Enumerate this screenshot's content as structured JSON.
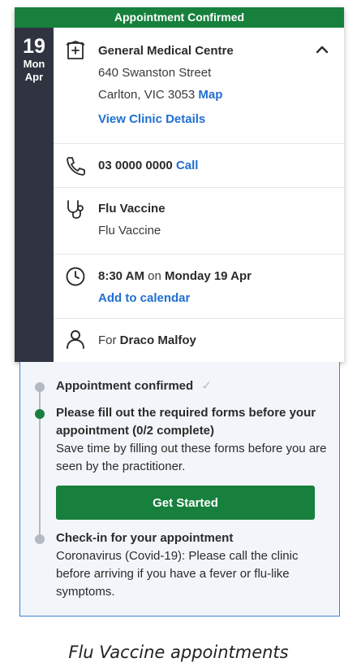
{
  "banner": {
    "text": "Appointment Confirmed"
  },
  "date": {
    "day": "19",
    "weekday": "Mon",
    "month": "Apr"
  },
  "clinic": {
    "name": "General Medical Centre",
    "address_line1": "640 Swanston Street",
    "address_line2": "Carlton, VIC 3053",
    "map_label": "Map",
    "details_label": "View Clinic Details"
  },
  "phone": {
    "number": "03 0000 0000",
    "call_label": "Call"
  },
  "service": {
    "name": "Flu Vaccine",
    "subtitle": "Flu Vaccine"
  },
  "time": {
    "time": "8:30 AM",
    "on": "on",
    "date": "Monday 19 Apr",
    "add_to_calendar": "Add to calendar"
  },
  "patient": {
    "for": "For",
    "name": "Draco Malfoy"
  },
  "steps": {
    "confirmed": {
      "title": "Appointment confirmed",
      "check": "✓"
    },
    "forms": {
      "title": "Please fill out the required forms before your appointment (0/2 complete)",
      "desc": "Save time by filling out these forms before you are seen by the practitioner.",
      "button": "Get Started"
    },
    "checkin": {
      "title": "Check-in for your appointment",
      "desc": "Coronavirus (Covid-19): Please call the clinic before arriving if you have a fever or flu-like symptoms."
    }
  },
  "caption": "Flu Vaccine appointments",
  "colors": {
    "brand_green": "#17803d",
    "link_blue": "#1f6fd1",
    "date_bg": "#2f3440"
  }
}
